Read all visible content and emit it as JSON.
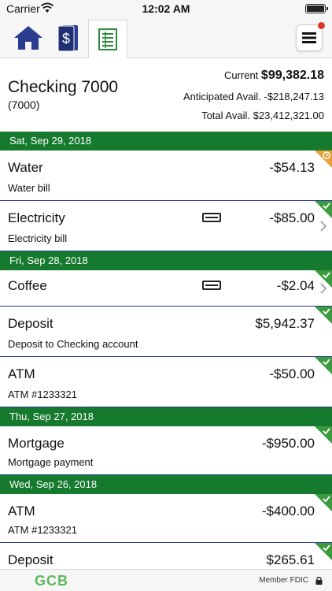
{
  "status_bar": {
    "carrier": "Carrier",
    "time": "12:02 AM"
  },
  "nav": {
    "icons": [
      "home-icon",
      "money-icon",
      "ledger-icon",
      "menu-icon"
    ],
    "accent": "#2a3d8f"
  },
  "account": {
    "name": "Checking 7000",
    "number": "(7000)",
    "current_label": "Current",
    "current_value": "$99,382.18",
    "anticipated_label": "Anticipated Avail.",
    "anticipated_value": "-$218,247.13",
    "total_label": "Total Avail.",
    "total_value": "$23,412,321.00"
  },
  "dates": [
    "Sat, Sep 29, 2018",
    "Fri, Sep 28, 2018",
    "Thu, Sep 27, 2018",
    "Wed, Sep 26, 2018"
  ],
  "transactions": [
    {
      "title": "Water",
      "amount": "-$54.13",
      "desc": "Water bill",
      "badge": "pending"
    },
    {
      "title": "Electricity",
      "amount": "-$85.00",
      "desc": "Electricity bill",
      "badge": "cleared"
    },
    {
      "title": "Coffee",
      "amount": "-$2.04",
      "desc": "",
      "badge": "cleared"
    },
    {
      "title": "Deposit",
      "amount": "$5,942.37",
      "desc": "Deposit to Checking account",
      "badge": "cleared"
    },
    {
      "title": "ATM",
      "amount": "-$50.00",
      "desc": "ATM #1233321",
      "badge": "cleared"
    },
    {
      "title": "Mortgage",
      "amount": "-$950.00",
      "desc": "Mortgage payment",
      "badge": "cleared"
    },
    {
      "title": "ATM",
      "amount": "-$400.00",
      "desc": "ATM #1233321",
      "badge": "cleared"
    },
    {
      "title": "Deposit",
      "amount": "$265.61",
      "desc": "",
      "badge": "cleared"
    }
  ],
  "footer": {
    "logo": "GCB",
    "fdic": "Member FDIC"
  },
  "colors": {
    "date_header": "#157a2e",
    "cleared": "#3a9b3f",
    "pending": "#e5a33a",
    "row_divider": "#2a3d8f"
  }
}
